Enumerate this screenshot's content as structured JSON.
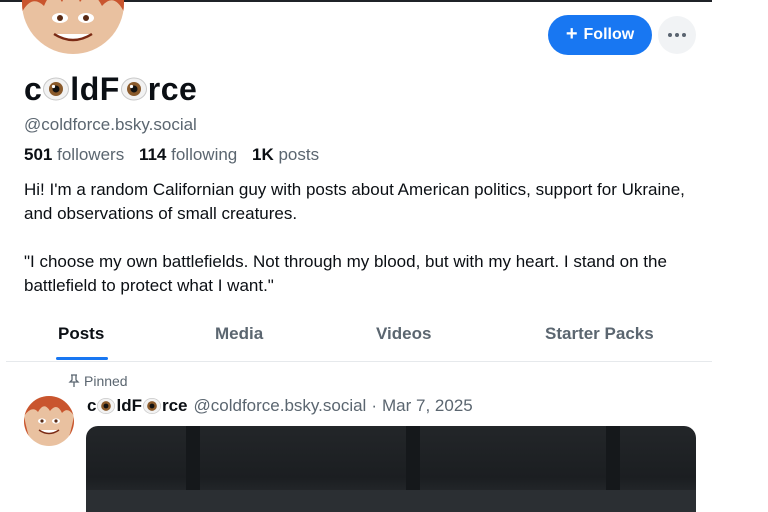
{
  "profile": {
    "name_parts": [
      "c",
      "ldF",
      "rce"
    ],
    "handle": "@coldforce.bsky.social",
    "followers_count": "501",
    "followers_label": "followers",
    "following_count": "114",
    "following_label": "following",
    "posts_count": "1K",
    "posts_label": "posts",
    "bio_line1": "Hi! I'm a random Californian guy with posts about American politics, support for Ukraine, and observations of small creatures.",
    "bio_line2": "\"I choose my own battlefields. Not through my blood, but with my heart. I stand on the battlefield to protect what I want.\""
  },
  "actions": {
    "follow_label": "Follow",
    "follow_icon": "plus-icon",
    "more_icon": "ellipsis-icon"
  },
  "tabs": [
    {
      "label": "Posts",
      "active": true
    },
    {
      "label": "Media",
      "active": false
    },
    {
      "label": "Videos",
      "active": false
    },
    {
      "label": "Starter Packs",
      "active": false
    }
  ],
  "pinned_post": {
    "pinned_label": "Pinned",
    "author_name_parts": [
      "c",
      "ldF",
      "rce"
    ],
    "author_handle": "@coldforce.bsky.social",
    "separator": "·",
    "date": "Mar 7, 2025"
  },
  "colors": {
    "accent": "#1877f2",
    "text_primary": "#0b0f14",
    "text_secondary": "#5b6670"
  }
}
